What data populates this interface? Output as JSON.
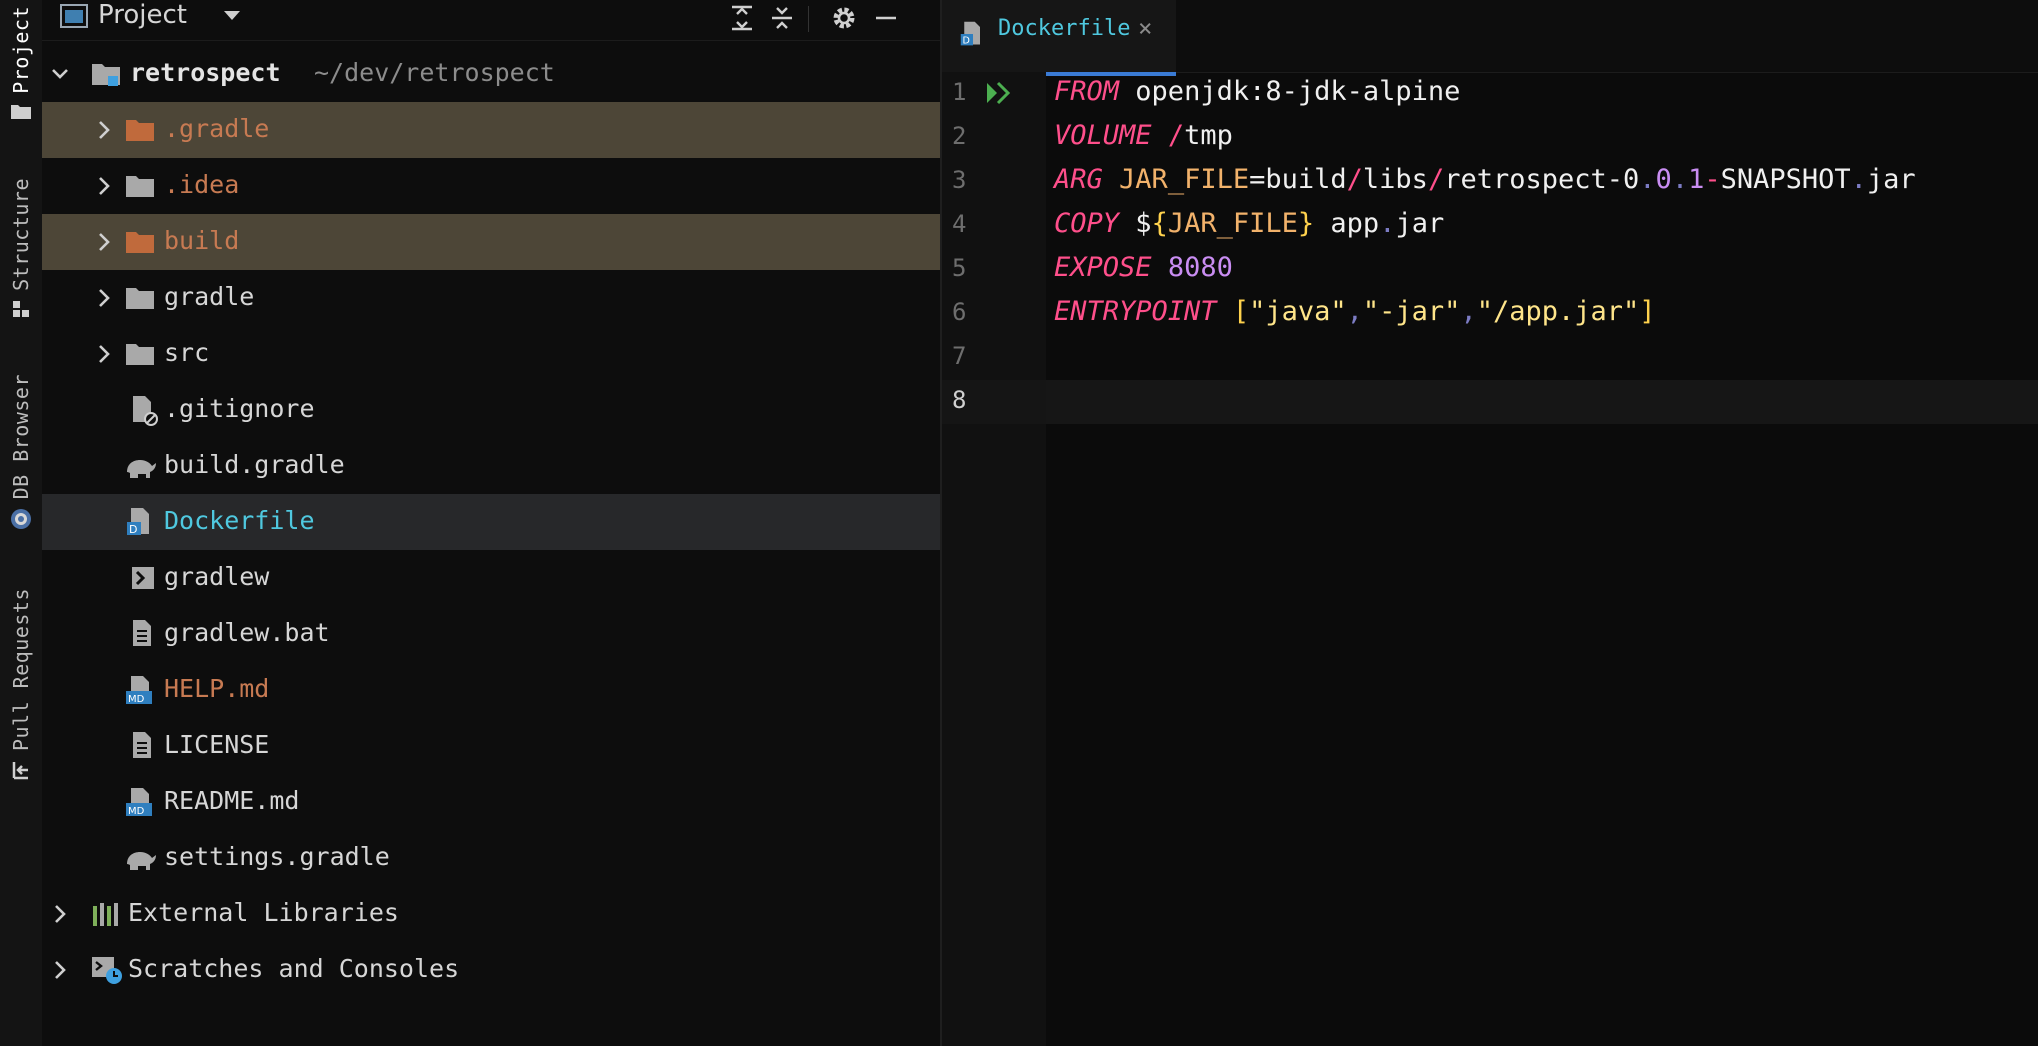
{
  "toolstrip": {
    "items": [
      {
        "label": "Project",
        "icon": "folder-icon"
      },
      {
        "label": "Structure",
        "icon": "structure-icon"
      },
      {
        "label": "DB Browser",
        "icon": "db-browser-icon"
      },
      {
        "label": "Pull Requests",
        "icon": "pull-request-icon"
      }
    ]
  },
  "project_panel": {
    "title": "Project",
    "tree": [
      {
        "label": "retrospect",
        "path": "~/dev/retrospect",
        "type": "root"
      },
      {
        "label": ".gradle",
        "type": "folder",
        "state": "ignored"
      },
      {
        "label": ".idea",
        "type": "folder",
        "state": "ignored"
      },
      {
        "label": "build",
        "type": "folder",
        "state": "ignored"
      },
      {
        "label": "gradle",
        "type": "folder"
      },
      {
        "label": "src",
        "type": "folder"
      },
      {
        "label": ".gitignore",
        "type": "file"
      },
      {
        "label": "build.gradle",
        "type": "file"
      },
      {
        "label": "Dockerfile",
        "type": "file",
        "state": "selected"
      },
      {
        "label": "gradlew",
        "type": "file"
      },
      {
        "label": "gradlew.bat",
        "type": "file"
      },
      {
        "label": "HELP.md",
        "type": "file",
        "state": "ignored"
      },
      {
        "label": "LICENSE",
        "type": "file"
      },
      {
        "label": "README.md",
        "type": "file"
      },
      {
        "label": "settings.gradle",
        "type": "file"
      },
      {
        "label": "External Libraries",
        "type": "group"
      },
      {
        "label": "Scratches and Consoles",
        "type": "group"
      }
    ]
  },
  "editor": {
    "tab": {
      "label": "Dockerfile",
      "close": "×"
    },
    "line_numbers": [
      "1",
      "2",
      "3",
      "4",
      "5",
      "6",
      "7",
      "8"
    ],
    "lines": [
      {
        "kw": "FROM",
        "rest": "openjdk:8-jdk-alpine"
      },
      {
        "kw": "VOLUME",
        "slash": "/",
        "rest": "tmp"
      },
      {
        "kw": "ARG",
        "var": "JAR_FILE",
        "eq": "=",
        "p1": "build",
        "s1": "/",
        "p2": "libs",
        "s2": "/",
        "p3": "retrospect-0",
        "d1": ".",
        "n1": "0",
        "d2": ".",
        "n2": "1",
        "dash": "-",
        "p4": "SNAPSHOT",
        "d3": ".",
        "p5": "jar"
      },
      {
        "kw": "COPY",
        "dollar": "$",
        "lb": "{",
        "var": "JAR_FILE",
        "rb": "}",
        "p1": "app",
        "d1": ".",
        "p2": "jar"
      },
      {
        "kw": "EXPOSE",
        "num": "8080"
      },
      {
        "kw": "ENTRYPOINT",
        "lbr": "[",
        "s1": "\"java\"",
        "c1": ",",
        "s2": "\"-jar\"",
        "c2": ",",
        "s3": "\"/app.jar\"",
        "rbr": "]"
      },
      {},
      {}
    ]
  }
}
